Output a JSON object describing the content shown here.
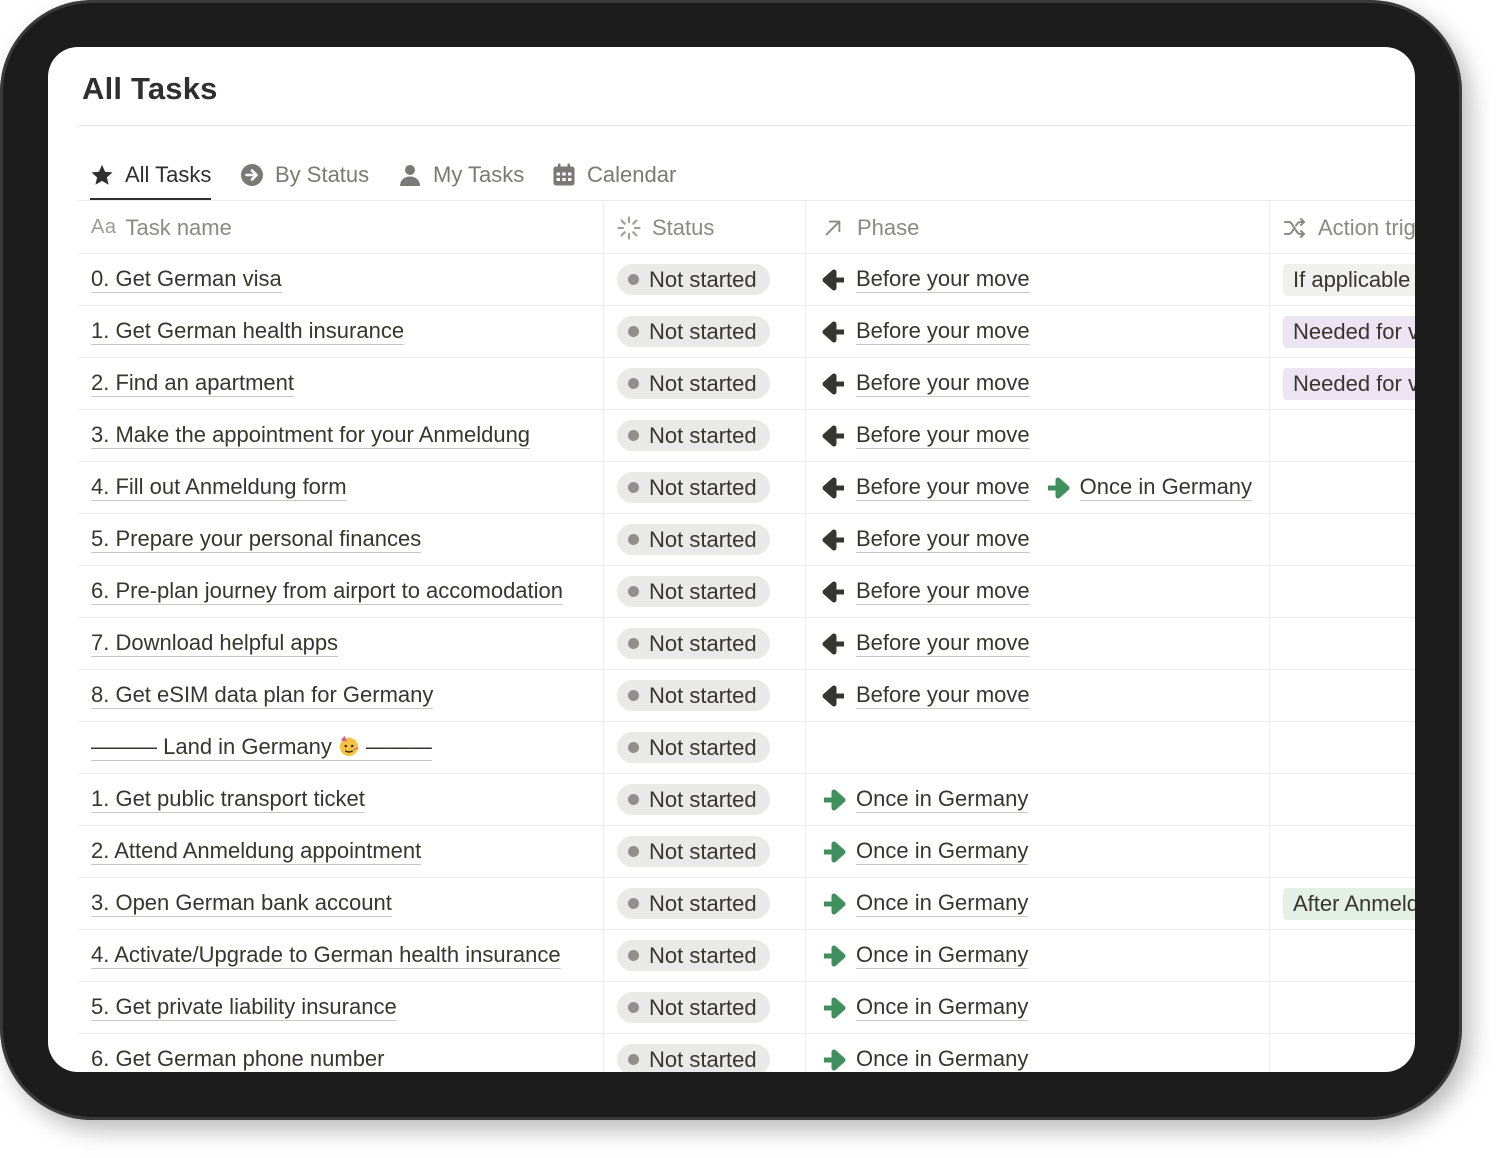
{
  "page": {
    "title": "All Tasks"
  },
  "tabs": [
    {
      "label": "All Tasks",
      "icon": "star-icon",
      "active": true
    },
    {
      "label": "By Status",
      "icon": "arrow-circle-right-icon",
      "active": false
    },
    {
      "label": "My Tasks",
      "icon": "person-icon",
      "active": false
    },
    {
      "label": "Calendar",
      "icon": "calendar-icon",
      "active": false
    }
  ],
  "columns": {
    "task_prefix": "Aa",
    "task": "Task name",
    "status": "Status",
    "phase": "Phase",
    "action": "Action trig"
  },
  "phases": {
    "before": {
      "label": "Before your move",
      "icon": "arrow-left-icon",
      "color": "#37352f"
    },
    "once": {
      "label": "Once in Germany",
      "icon": "arrow-right-icon",
      "color": "#3f8f5f"
    }
  },
  "status_options": {
    "not_started": "Not started"
  },
  "rows": [
    {
      "task": "0. Get German visa",
      "status": "Not started",
      "phases": [
        "Before your move"
      ],
      "action": "If applicable",
      "action_color": "gray"
    },
    {
      "task": "1. Get German health insurance",
      "status": "Not started",
      "phases": [
        "Before your move"
      ],
      "action": "Needed for v",
      "action_color": "purple"
    },
    {
      "task": "2. Find an apartment",
      "status": "Not started",
      "phases": [
        "Before your move"
      ],
      "action": "Needed for v",
      "action_color": "purple"
    },
    {
      "task": "3. Make the appointment for your Anmeldung",
      "status": "Not started",
      "phases": [
        "Before your move"
      ],
      "action": "",
      "action_color": ""
    },
    {
      "task": "4. Fill out Anmeldung form",
      "status": "Not started",
      "phases": [
        "Before your move",
        "Once in Germany"
      ],
      "action": "",
      "action_color": ""
    },
    {
      "task": "5. Prepare your personal finances",
      "status": "Not started",
      "phases": [
        "Before your move"
      ],
      "action": "",
      "action_color": ""
    },
    {
      "task": "6. Pre-plan journey from airport to accomodation",
      "status": "Not started",
      "phases": [
        "Before your move"
      ],
      "action": "",
      "action_color": ""
    },
    {
      "task": "7. Download helpful apps",
      "status": "Not started",
      "phases": [
        "Before your move"
      ],
      "action": "",
      "action_color": ""
    },
    {
      "task": "8. Get eSIM data plan for Germany",
      "status": "Not started",
      "phases": [
        "Before your move"
      ],
      "action": "",
      "action_color": ""
    },
    {
      "task": "——— Land in Germany",
      "task_suffix": "———",
      "task_emoji": "partying-face-icon",
      "status": "Not started",
      "phases": [],
      "action": "",
      "action_color": ""
    },
    {
      "task": "1. Get public transport ticket",
      "status": "Not started",
      "phases": [
        "Once in Germany"
      ],
      "action": "",
      "action_color": ""
    },
    {
      "task": "2. Attend Anmeldung appointment",
      "status": "Not started",
      "phases": [
        "Once in Germany"
      ],
      "action": "",
      "action_color": ""
    },
    {
      "task": "3. Open German bank account",
      "status": "Not started",
      "phases": [
        "Once in Germany"
      ],
      "action": "After Anmeld",
      "action_color": "green"
    },
    {
      "task": "4. Activate/Upgrade to German health insurance",
      "status": "Not started",
      "phases": [
        "Once in Germany"
      ],
      "action": "",
      "action_color": ""
    },
    {
      "task": "5. Get private liability insurance",
      "status": "Not started",
      "phases": [
        "Once in Germany"
      ],
      "action": "",
      "action_color": ""
    },
    {
      "task": "6. Get German phone number",
      "status": "Not started",
      "phases": [
        "Once in Germany"
      ],
      "action": "",
      "action_color": ""
    }
  ]
}
